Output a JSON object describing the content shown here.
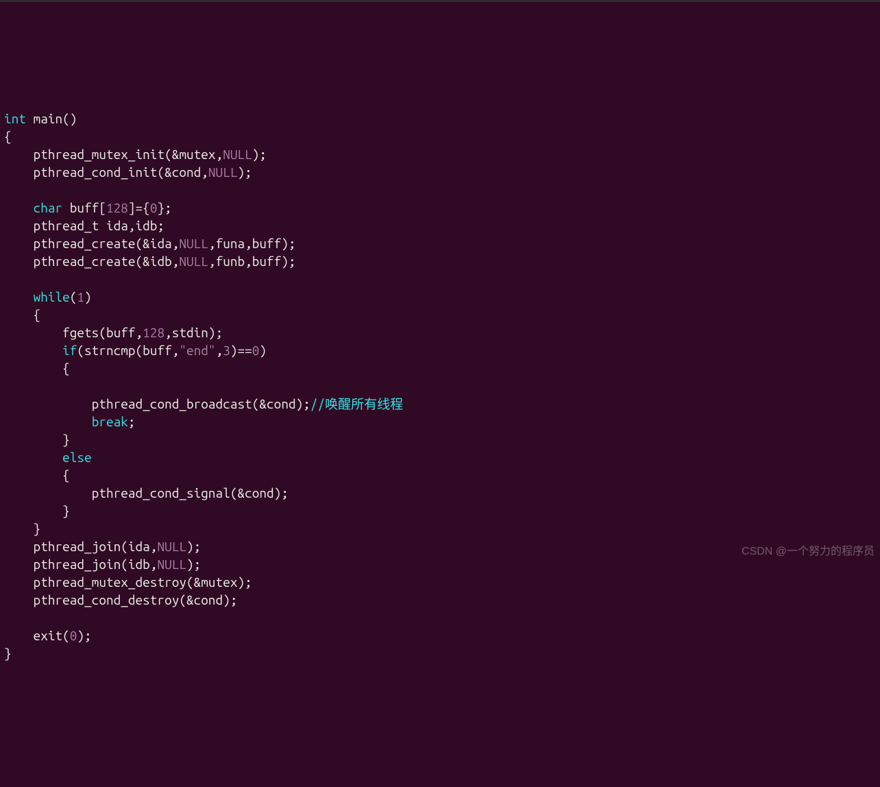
{
  "code": {
    "lines": [
      [
        {
          "t": "int",
          "c": "kw"
        },
        {
          "t": " main()",
          "c": ""
        }
      ],
      [
        {
          "t": "{",
          "c": ""
        }
      ],
      [
        {
          "t": "    pthread_mutex_init(&mutex,",
          "c": ""
        },
        {
          "t": "NULL",
          "c": "null"
        },
        {
          "t": ");",
          "c": ""
        }
      ],
      [
        {
          "t": "    pthread_cond_init(&cond,",
          "c": ""
        },
        {
          "t": "NULL",
          "c": "null"
        },
        {
          "t": ");",
          "c": ""
        }
      ],
      [
        {
          "t": "",
          "c": ""
        }
      ],
      [
        {
          "t": "    ",
          "c": ""
        },
        {
          "t": "char",
          "c": "kw"
        },
        {
          "t": " buff[",
          "c": ""
        },
        {
          "t": "128",
          "c": "num"
        },
        {
          "t": "]={",
          "c": ""
        },
        {
          "t": "0",
          "c": "num"
        },
        {
          "t": "};",
          "c": ""
        }
      ],
      [
        {
          "t": "    pthread_t ida,idb;",
          "c": ""
        }
      ],
      [
        {
          "t": "    pthread_create(&ida,",
          "c": ""
        },
        {
          "t": "NULL",
          "c": "null"
        },
        {
          "t": ",funa,buff);",
          "c": ""
        }
      ],
      [
        {
          "t": "    pthread_create(&idb,",
          "c": ""
        },
        {
          "t": "NULL",
          "c": "null"
        },
        {
          "t": ",funb,buff);",
          "c": ""
        }
      ],
      [
        {
          "t": "",
          "c": ""
        }
      ],
      [
        {
          "t": "    ",
          "c": ""
        },
        {
          "t": "while",
          "c": "kw"
        },
        {
          "t": "(",
          "c": ""
        },
        {
          "t": "1",
          "c": "num"
        },
        {
          "t": ")",
          "c": ""
        }
      ],
      [
        {
          "t": "    {",
          "c": ""
        }
      ],
      [
        {
          "t": "        fgets(buff,",
          "c": ""
        },
        {
          "t": "128",
          "c": "num"
        },
        {
          "t": ",stdin);",
          "c": ""
        }
      ],
      [
        {
          "t": "        ",
          "c": ""
        },
        {
          "t": "if",
          "c": "kw"
        },
        {
          "t": "(strncmp(buff,",
          "c": ""
        },
        {
          "t": "\"end\"",
          "c": "str"
        },
        {
          "t": ",",
          "c": ""
        },
        {
          "t": "3",
          "c": "num"
        },
        {
          "t": ")==",
          "c": ""
        },
        {
          "t": "0",
          "c": "num"
        },
        {
          "t": ")",
          "c": ""
        }
      ],
      [
        {
          "t": "        {",
          "c": ""
        }
      ],
      [
        {
          "t": "",
          "c": ""
        }
      ],
      [
        {
          "t": "            pthread_cond_broadcast(&cond);",
          "c": ""
        },
        {
          "t": "//唤醒所有线程",
          "c": "cmt"
        }
      ],
      [
        {
          "t": "            ",
          "c": ""
        },
        {
          "t": "break",
          "c": "kw"
        },
        {
          "t": ";",
          "c": ""
        }
      ],
      [
        {
          "t": "        }",
          "c": ""
        }
      ],
      [
        {
          "t": "        ",
          "c": ""
        },
        {
          "t": "else",
          "c": "kw"
        }
      ],
      [
        {
          "t": "        {",
          "c": ""
        }
      ],
      [
        {
          "t": "            pthread_cond_signal(&cond);",
          "c": ""
        }
      ],
      [
        {
          "t": "        }",
          "c": ""
        }
      ],
      [
        {
          "t": "    }",
          "c": ""
        }
      ],
      [
        {
          "t": "    pthread_join(ida,",
          "c": ""
        },
        {
          "t": "NULL",
          "c": "null"
        },
        {
          "t": ");",
          "c": ""
        }
      ],
      [
        {
          "t": "    pthread_join(idb,",
          "c": ""
        },
        {
          "t": "NULL",
          "c": "null"
        },
        {
          "t": ");",
          "c": ""
        }
      ],
      [
        {
          "t": "    pthread_mutex_destroy(&mutex);",
          "c": ""
        }
      ],
      [
        {
          "t": "    pthread_cond_destroy(&cond);",
          "c": ""
        }
      ],
      [
        {
          "t": "",
          "c": ""
        }
      ],
      [
        {
          "t": "    exit(",
          "c": ""
        },
        {
          "t": "0",
          "c": "num"
        },
        {
          "t": ");",
          "c": ""
        }
      ],
      [
        {
          "t": "}",
          "c": ""
        }
      ]
    ]
  },
  "watermark": "CSDN @一个努力的程序员"
}
